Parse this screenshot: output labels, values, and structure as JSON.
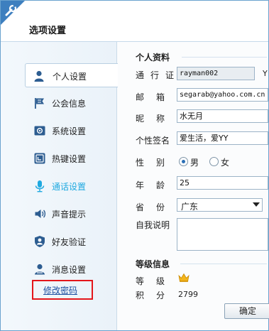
{
  "window": {
    "title": "选项设置"
  },
  "nav": {
    "items": [
      {
        "label": "个人设置",
        "icon": "person-icon",
        "active": true
      },
      {
        "label": "公会信息",
        "icon": "flag-icon"
      },
      {
        "label": "系统设置",
        "icon": "system-settings-icon"
      },
      {
        "label": "热键设置",
        "icon": "keyboard-key-icon"
      },
      {
        "label": "通话设置",
        "icon": "microphone-icon",
        "highlight": true
      },
      {
        "label": "声音提示",
        "icon": "speaker-icon"
      },
      {
        "label": "好友验证",
        "icon": "shield-person-icon"
      },
      {
        "label": "消息设置",
        "icon": "message-person-icon"
      }
    ],
    "change_password": "修改密码"
  },
  "profile": {
    "section_title": "个人资料",
    "passport_label": "通行证",
    "passport_value": "rayman002",
    "passport_trailing": "Y",
    "email_label": "邮箱",
    "email_value": "segarab@yahoo.com.cn",
    "nickname_label": "昵称",
    "nickname_value": "水无月",
    "signature_label": "个性签名",
    "signature_value": "爱生活，爱YY",
    "gender_label": "性别",
    "gender_male": "男",
    "gender_female": "女",
    "gender_selected": "male",
    "age_label": "年龄",
    "age_value": "25",
    "province_label": "省份",
    "province_value": "广东",
    "intro_label": "自我说明",
    "intro_value": ""
  },
  "level": {
    "section_title": "等级信息",
    "grade_label": "等级",
    "points_label": "积分",
    "points_value": "2799"
  },
  "buttons": {
    "ok": "确定"
  },
  "colors": {
    "accent": "#3d7fbf",
    "highlight": "#1fa9e0",
    "annotation": "#e4161b",
    "link": "#1c4fa0"
  }
}
